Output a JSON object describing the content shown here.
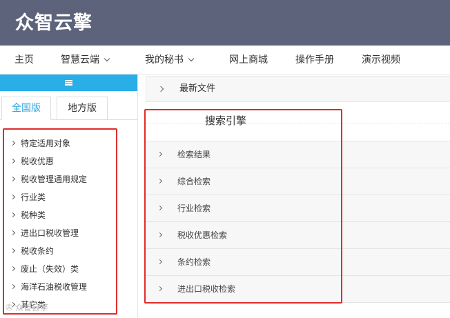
{
  "header": {
    "logo": "众智云擎"
  },
  "nav": {
    "items": [
      {
        "label": "主页",
        "dropdown": false
      },
      {
        "label": "智慧云端",
        "dropdown": true
      },
      {
        "label": "我的秘书",
        "dropdown": true
      },
      {
        "label": "网上商城",
        "dropdown": false
      },
      {
        "label": "操作手册",
        "dropdown": false
      },
      {
        "label": "演示视频",
        "dropdown": false
      }
    ]
  },
  "sidebar": {
    "toggle_icon": "hamburger-icon",
    "tabs": [
      {
        "label": "全国版",
        "active": true
      },
      {
        "label": "地方版",
        "active": false
      }
    ],
    "categories": [
      "特定适用对象",
      "税收优惠",
      "税收管理通用规定",
      "行业类",
      "税种类",
      "进出口税收管理",
      "税收条约",
      "废止（失效）类",
      "海洋石油税收管理",
      "其它类"
    ],
    "accent_color": "#29aee8"
  },
  "main": {
    "latest_files": "最新文件",
    "search_engine": {
      "title": "搜索引擎",
      "items": [
        "检索结果",
        "综合检索",
        "行业检索",
        "税收优惠检索",
        "条约检索",
        "进出口税收检索"
      ]
    }
  },
  "watermark": "✇ 众智云擎"
}
